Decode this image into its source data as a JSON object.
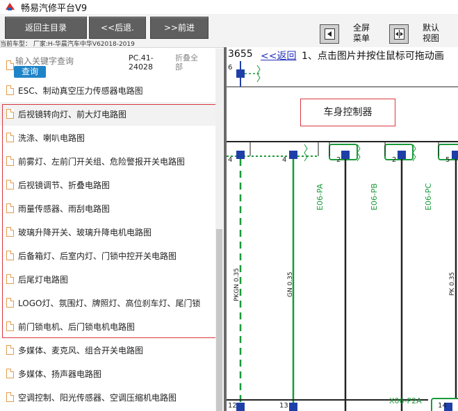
{
  "app": {
    "title": "畅易汽修平台V9"
  },
  "toolbar": {
    "home_label": "返回主目录",
    "back_label": "<<后退.",
    "forward_label": ">>前进",
    "fullscreen_label_1": "全屏",
    "fullscreen_label_2": "菜单",
    "default_label_1": "默认",
    "default_label_2": "视图"
  },
  "vehicle": {
    "text": "当前车型： 厂家:H-华晨汽车中华V62018-2019"
  },
  "search": {
    "placeholder": "输入关键字查询",
    "button_label": "查询",
    "pc_code": "PC.41-24028",
    "collapse_all_1": "折叠全",
    "collapse_all_2": "部"
  },
  "list": {
    "items": [
      {
        "label": "ESC、制动真空压力传感器电路图"
      },
      {
        "label": "后视镜转向灯、前大灯电路图"
      },
      {
        "label": "洗涤、喇叭电路图"
      },
      {
        "label": "前雾灯、左前门开关组、危险警报开关电路图"
      },
      {
        "label": "后视镜调节、折叠电路图"
      },
      {
        "label": "雨量传感器、雨刮电路图"
      },
      {
        "label": "玻璃升降开关、玻璃升降电机电路图"
      },
      {
        "label": "后备箱灯、后室内灯、门锁中控开关电路图"
      },
      {
        "label": "后尾灯电路图"
      },
      {
        "label": "LOGO灯、氛围灯、牌照灯、高位刹车灯、尾门锁"
      },
      {
        "label": "前门锁电机、后门锁电机电路图"
      },
      {
        "label": "多媒体、麦克风、组合开关电路图"
      },
      {
        "label": "多媒体、扬声器电路图"
      },
      {
        "label": "空调控制、阳光传感器、空调压缩机电路图"
      }
    ]
  },
  "viewer": {
    "page_number": "3655",
    "back_link": "<<返回",
    "hint": "1、点击图片并按住鼠标可拖动画"
  },
  "diagram": {
    "module_label": "车身控制器",
    "pin_top": "6",
    "pins": [
      "4",
      "4",
      "2",
      "2",
      "5"
    ],
    "connectors": [
      "E06-PA",
      "E06-PB",
      "E06-PC"
    ],
    "wires": [
      "PKGN 0.35",
      "GN 0.35",
      "PK 0.35"
    ],
    "bottom_connector": "X06-P2A",
    "bottom_pins": [
      "12",
      "13",
      "14"
    ],
    "colors": {
      "wire_green": "#1a9a3a",
      "pin_blue": "#1f3fa8",
      "highlight_red": "#d9363e"
    }
  }
}
